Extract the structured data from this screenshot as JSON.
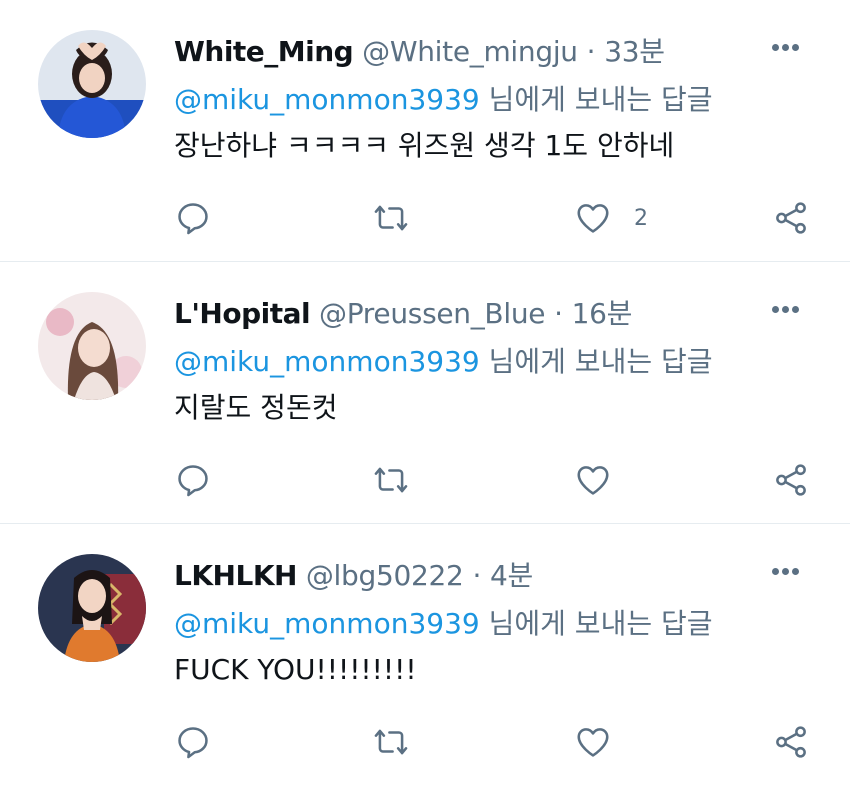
{
  "tweets": [
    {
      "name": "White_Ming",
      "handle": "@White_mingju",
      "time": "33분",
      "reply_to": "@miku_monmon3939",
      "reply_word": "님에게 보내는 답글",
      "text": "장난하냐 ㅋㅋㅋㅋ 위즈원 생각 1도 안하네",
      "like_count": "2"
    },
    {
      "name": "L'Hopital",
      "handle": "@Preussen_Blue",
      "time": "16분",
      "reply_to": "@miku_monmon3939",
      "reply_word": "님에게 보내는 답글",
      "text": "지랄도 정돈컷",
      "like_count": ""
    },
    {
      "name": "LKHLKH",
      "handle": "@lbg50222",
      "time": "4분",
      "reply_to": "@miku_monmon3939",
      "reply_word": "님에게 보내는 답글",
      "text": "FUCK YOU!!!!!!!!!",
      "like_count": ""
    }
  ],
  "separator": "·",
  "icons": [
    "reply-icon",
    "retweet-icon",
    "like-icon",
    "share-icon",
    "more-icon"
  ],
  "colors": {
    "mention": "#1b95e0",
    "secondary_text": "#5b7083",
    "icon": "#5b7083",
    "divider": "#e6ecf0"
  }
}
